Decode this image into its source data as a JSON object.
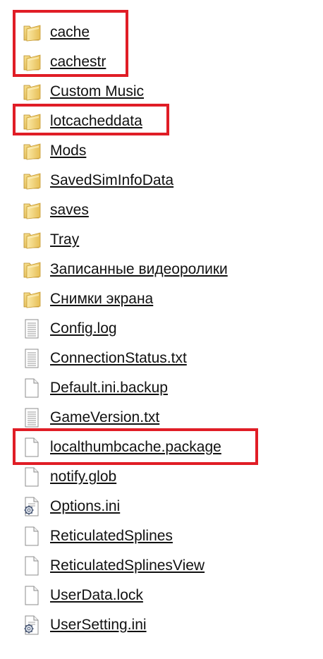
{
  "files": [
    {
      "name": "cache",
      "icon": "folder-icon"
    },
    {
      "name": "cachestr",
      "icon": "folder-icon"
    },
    {
      "name": "Custom Music",
      "icon": "folder-icon"
    },
    {
      "name": "lotcacheddata",
      "icon": "folder-icon"
    },
    {
      "name": "Mods",
      "icon": "folder-icon"
    },
    {
      "name": "SavedSimInfoData",
      "icon": "folder-icon"
    },
    {
      "name": "saves",
      "icon": "folder-icon"
    },
    {
      "name": "Tray",
      "icon": "folder-icon"
    },
    {
      "name": "Записанные видеоролики",
      "icon": "folder-icon"
    },
    {
      "name": "Снимки экрана",
      "icon": "folder-icon"
    },
    {
      "name": "Config.log",
      "icon": "text-file-icon"
    },
    {
      "name": "ConnectionStatus.txt",
      "icon": "text-file-icon"
    },
    {
      "name": "Default.ini.backup",
      "icon": "file-icon"
    },
    {
      "name": "GameVersion.txt",
      "icon": "text-file-icon"
    },
    {
      "name": "localthumbcache.package",
      "icon": "file-icon"
    },
    {
      "name": "notify.glob",
      "icon": "file-icon"
    },
    {
      "name": "Options.ini",
      "icon": "settings-file-icon"
    },
    {
      "name": "ReticulatedSplines",
      "icon": "file-icon"
    },
    {
      "name": "ReticulatedSplinesView",
      "icon": "file-icon"
    },
    {
      "name": "UserData.lock",
      "icon": "file-icon"
    },
    {
      "name": "UserSetting.ini",
      "icon": "settings-file-icon"
    }
  ],
  "highlighted": [
    "cache",
    "cachestr",
    "lotcacheddata",
    "localthumbcache.package"
  ],
  "colors": {
    "highlight": "#e01d26",
    "folder": "#e8c45a",
    "text": "#111111"
  }
}
